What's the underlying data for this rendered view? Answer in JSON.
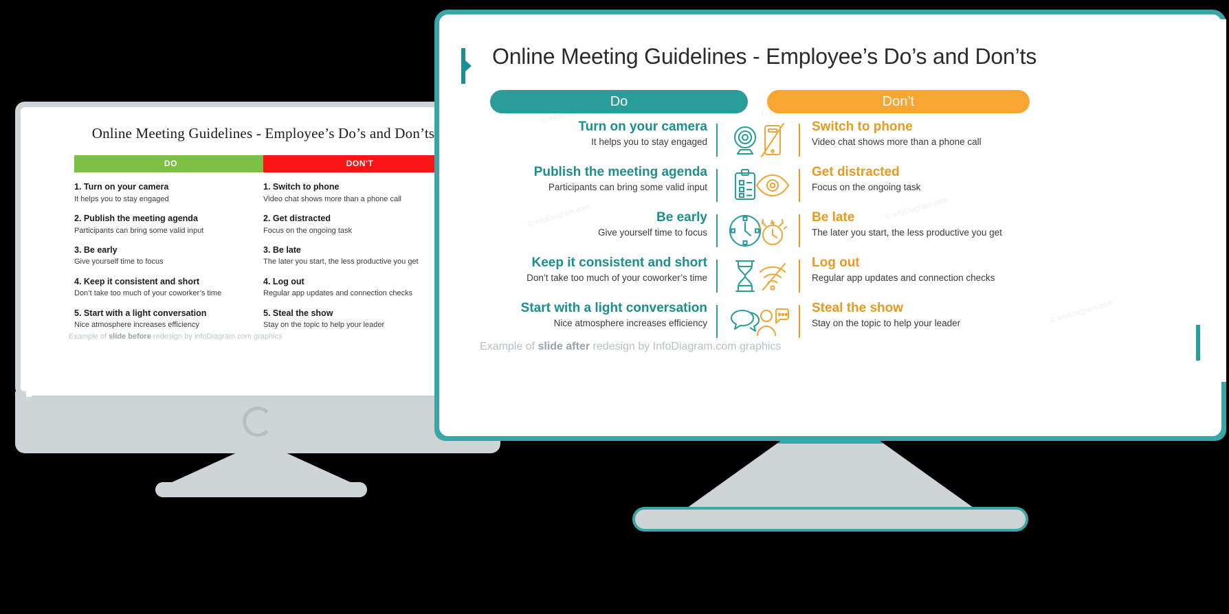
{
  "before_slide": {
    "title": "Online Meeting Guidelines - Employee’s Do’s and Don’ts",
    "do_header": "DO",
    "dont_header": "DON'T",
    "do_items": [
      {
        "title": "1. Turn on your camera",
        "sub": "It helps you to stay engaged"
      },
      {
        "title": "2. Publish the meeting agenda",
        "sub": "Participants can bring some valid input"
      },
      {
        "title": "3. Be early",
        "sub": "Give yourself time to focus"
      },
      {
        "title": "4. Keep it consistent and short",
        "sub": "Don’t take too much of your coworker’s time"
      },
      {
        "title": "5. Start with a light conversation",
        "sub": "Nice atmosphere increases efficiency"
      }
    ],
    "dont_items": [
      {
        "title": "1. Switch to phone",
        "sub": "Video chat shows more than a phone call"
      },
      {
        "title": "2. Get distracted",
        "sub": "Focus on the ongoing task"
      },
      {
        "title": "3. Be late",
        "sub": "The later you start, the less productive you get"
      },
      {
        "title": "4. Log out",
        "sub": "Regular app updates and connection checks"
      },
      {
        "title": "5. Steal the show",
        "sub": "Stay on the topic to help your leader"
      }
    ],
    "footer_pre": "Example of ",
    "footer_bold": "slide before",
    "footer_post": " redesign by infoDiagram.com graphics",
    "colors": {
      "do": "#7ac143",
      "dont": "#fa1414",
      "bezel": "#cfd4d6"
    }
  },
  "after_slide": {
    "title": "Online Meeting Guidelines - Employee’s Do’s and Don’ts",
    "do_pill": "Do",
    "dont_pill": "Don’t",
    "rows": [
      {
        "do_title": "Turn on your camera",
        "do_sub": "It helps you to stay engaged",
        "do_icon": "webcam-icon",
        "dont_icon": "phone-crossed-out-icon",
        "dont_title": "Switch to phone",
        "dont_sub": "Video chat shows more than a phone call"
      },
      {
        "do_title": "Publish the meeting agenda",
        "do_sub": "Participants can bring some valid input",
        "do_icon": "clipboard-checklist-icon",
        "dont_icon": "eye-icon",
        "dont_title": "Get distracted",
        "dont_sub": "Focus on the ongoing task"
      },
      {
        "do_title": "Be early",
        "do_sub": "Give yourself time to focus",
        "do_icon": "clock-icon",
        "dont_icon": "alarm-clock-ringing-icon",
        "dont_title": "Be late",
        "dont_sub": "The later you start, the less productive you get"
      },
      {
        "do_title": "Keep it consistent and short",
        "do_sub": "Don’t take too much of your coworker’s time",
        "do_icon": "hourglass-icon",
        "dont_icon": "wifi-disconnected-icon",
        "dont_title": "Log out",
        "dont_sub": "Regular app updates and connection checks"
      },
      {
        "do_title": "Start with a light conversation",
        "do_sub": "Nice atmosphere increases efficiency",
        "do_icon": "speech-bubbles-icon",
        "dont_icon": "person-talking-icon",
        "dont_title": "Steal the show",
        "dont_sub": "Stay on the topic to help your leader"
      }
    ],
    "footer_pre": "Example of ",
    "footer_bold": "slide after",
    "footer_post": " redesign by InfoDiagram.com graphics",
    "colors": {
      "teal": "#2a9d9a",
      "orange": "#f6a631",
      "title": "#2b2b2b",
      "bezel": "#cfd4d6"
    }
  },
  "watermarks": [
    "© infoDiagram.com",
    "© infoDiagram.com",
    "© infoDiagram.com",
    "© infoDiagram.com",
    "© infoDiagram.com"
  ]
}
